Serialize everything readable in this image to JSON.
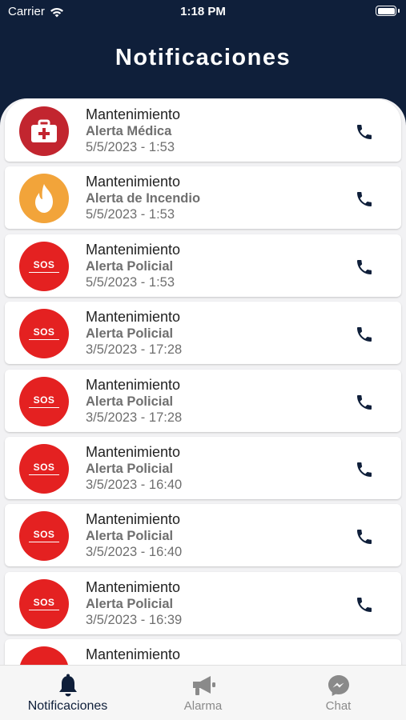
{
  "status_bar": {
    "carrier": "Carrier",
    "time": "1:18 PM"
  },
  "header": {
    "title": "Notificaciones"
  },
  "notifications": [
    {
      "title": "Mantenimiento",
      "type": "Alerta Médica",
      "datetime": "5/5/2023 - 1:53",
      "icon": "medical-kit-icon"
    },
    {
      "title": "Mantenimiento",
      "type": "Alerta de Incendio",
      "datetime": "5/5/2023 - 1:53",
      "icon": "fire-icon"
    },
    {
      "title": "Mantenimiento",
      "type": "Alerta Policial",
      "datetime": "5/5/2023 - 1:53",
      "icon": "sos-icon",
      "icon_text": "SOS"
    },
    {
      "title": "Mantenimiento",
      "type": "Alerta Policial",
      "datetime": "3/5/2023 - 17:28",
      "icon": "sos-icon",
      "icon_text": "SOS"
    },
    {
      "title": "Mantenimiento",
      "type": "Alerta Policial",
      "datetime": "3/5/2023 - 17:28",
      "icon": "sos-icon",
      "icon_text": "SOS"
    },
    {
      "title": "Mantenimiento",
      "type": "Alerta Policial",
      "datetime": "3/5/2023 - 16:40",
      "icon": "sos-icon",
      "icon_text": "SOS"
    },
    {
      "title": "Mantenimiento",
      "type": "Alerta Policial",
      "datetime": "3/5/2023 - 16:40",
      "icon": "sos-icon",
      "icon_text": "SOS"
    },
    {
      "title": "Mantenimiento",
      "type": "Alerta Policial",
      "datetime": "3/5/2023 - 16:39",
      "icon": "sos-icon",
      "icon_text": "SOS"
    },
    {
      "title": "Mantenimiento",
      "type": "",
      "datetime": "",
      "icon": "sos-icon",
      "icon_text": ""
    }
  ],
  "tab_bar": {
    "items": [
      {
        "label": "Notificaciones",
        "icon": "bell-icon",
        "active": true
      },
      {
        "label": "Alarma",
        "icon": "megaphone-icon",
        "active": false
      },
      {
        "label": "Chat",
        "icon": "messenger-icon",
        "active": false
      }
    ]
  },
  "colors": {
    "header_bg": "#0f1f3a",
    "medical": "#c2252f",
    "fire": "#f2a43a",
    "police": "#e42121",
    "phone_icon": "#0f1f3a"
  }
}
